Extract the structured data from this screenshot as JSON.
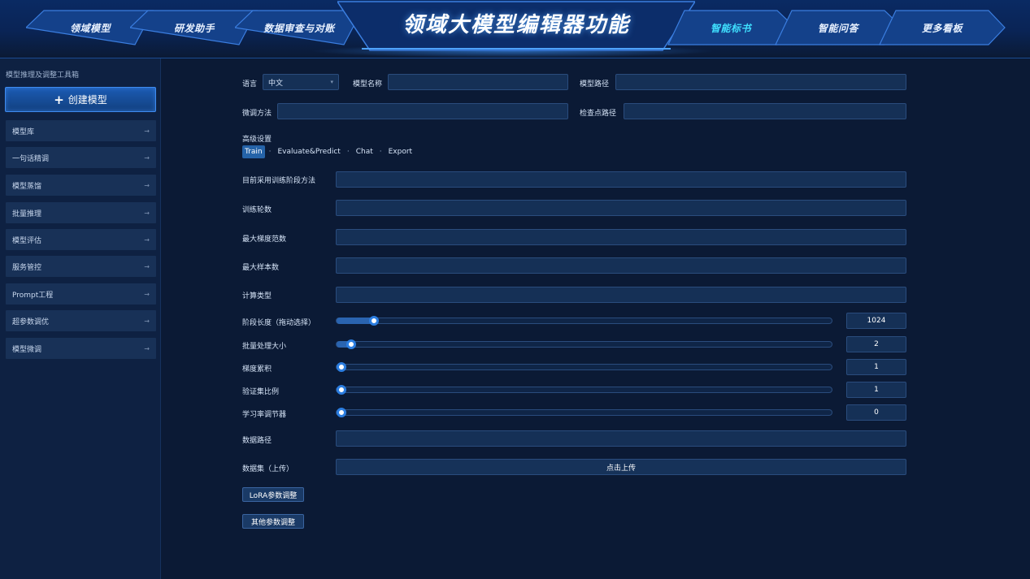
{
  "header": {
    "title": "领域大模型编辑器功能",
    "nav_left": [
      {
        "label": "领域模型"
      },
      {
        "label": "研发助手"
      },
      {
        "label": "数据审查与对账"
      }
    ],
    "nav_right": [
      {
        "label": "智能标书",
        "active": true
      },
      {
        "label": "智能问答"
      },
      {
        "label": "更多看板"
      }
    ]
  },
  "sidebar": {
    "title": "模型推理及调整工具箱",
    "create_button": "创建模型",
    "items": [
      {
        "label": "模型库"
      },
      {
        "label": "一句话精调"
      },
      {
        "label": "模型蒸馏"
      },
      {
        "label": "批量推理"
      },
      {
        "label": "模型评估"
      },
      {
        "label": "服务管控"
      },
      {
        "label": "Prompt工程"
      },
      {
        "label": "超参数调优"
      },
      {
        "label": "模型微调"
      }
    ]
  },
  "form": {
    "language_label": "语言",
    "language_value": "中文",
    "model_name_label": "模型名称",
    "model_name_value": "",
    "model_path_label": "模型路径",
    "model_path_value": "",
    "finetune_method_label": "微调方法",
    "finetune_method_value": "",
    "checkpoint_path_label": "检查点路径",
    "checkpoint_path_value": "",
    "advanced_label": "高级设置",
    "tabs": [
      "Train",
      "Evaluate&Predict",
      "Chat",
      "Export"
    ],
    "active_tab": "Train",
    "stage_method_label": "目前采用训练阶段方法",
    "epochs_label": "训练轮数",
    "max_grad_norm_label": "最大梯度范数",
    "max_samples_label": "最大样本数",
    "compute_type_label": "计算类型",
    "sliders": [
      {
        "label": "阶段长度（拖动选择）",
        "value": "1024",
        "fraction": 0.065
      },
      {
        "label": "批量处理大小",
        "value": "2",
        "fraction": 0.02
      },
      {
        "label": "梯度累积",
        "value": "1",
        "fraction": 0.0
      },
      {
        "label": "验证集比例",
        "value": "1",
        "fraction": 0.0
      },
      {
        "label": "学习率调节器",
        "value": "0",
        "fraction": 0.0
      }
    ],
    "data_path_label": "数据路径",
    "dataset_label": "数据集（上传）",
    "upload_button": "点击上传",
    "lora_button": "LoRA参数调整",
    "other_button": "其他参数调整"
  },
  "colors": {
    "background": "#0b1a35",
    "accent": "#2b7de0",
    "active_nav": "#3fe0ff"
  }
}
